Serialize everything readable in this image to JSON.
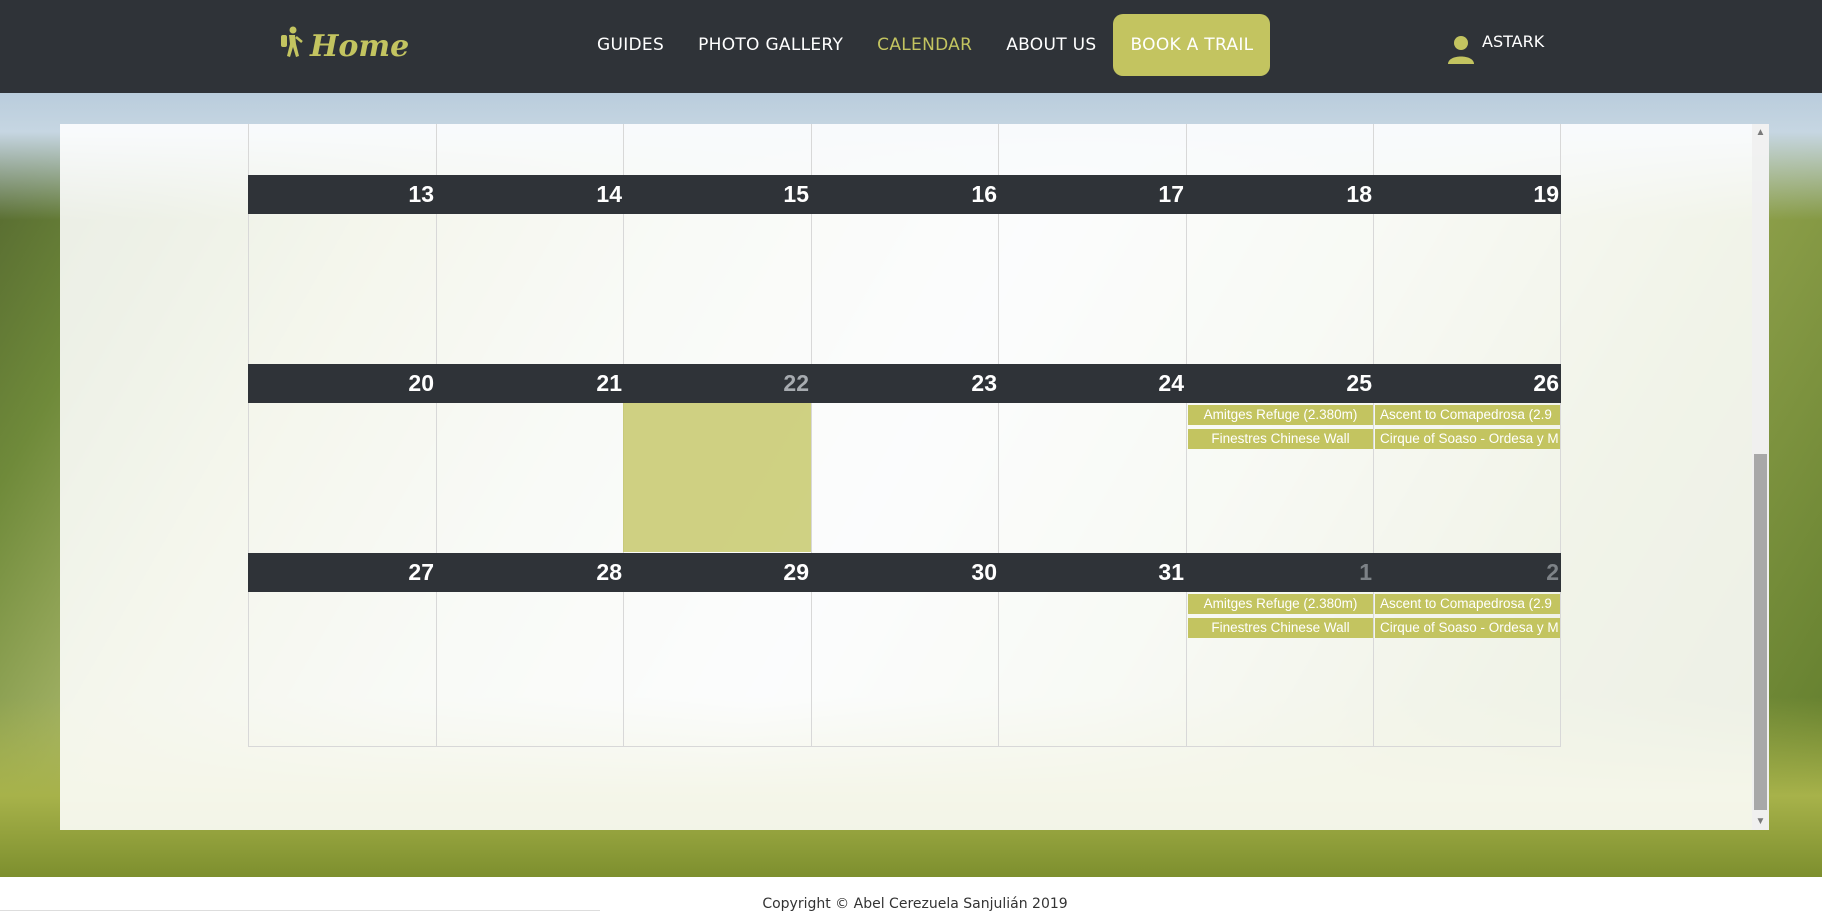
{
  "navbar": {
    "brand": "Home",
    "links": [
      {
        "label": "GUIDES",
        "active": false
      },
      {
        "label": "PHOTO GALLERY",
        "active": false
      },
      {
        "label": "CALENDAR",
        "active": true
      },
      {
        "label": "ABOUT US",
        "active": false
      }
    ],
    "book_button": "BOOK A TRAIL",
    "user": "ASTARK"
  },
  "colors": {
    "accent": "#c3c460",
    "navbar": "#2f3338",
    "week_header": "#2f3338"
  },
  "icons": {
    "brand": "hiker-icon",
    "user": "user-icon"
  },
  "calendar": {
    "weeks": [
      {
        "days": [
          {
            "num": "13"
          },
          {
            "num": "14"
          },
          {
            "num": "15"
          },
          {
            "num": "16"
          },
          {
            "num": "17"
          },
          {
            "num": "18"
          },
          {
            "num": "19"
          }
        ]
      },
      {
        "days": [
          {
            "num": "20"
          },
          {
            "num": "21"
          },
          {
            "num": "22",
            "today": true
          },
          {
            "num": "23"
          },
          {
            "num": "24"
          },
          {
            "num": "25"
          },
          {
            "num": "26"
          }
        ]
      },
      {
        "days": [
          {
            "num": "27"
          },
          {
            "num": "28"
          },
          {
            "num": "29"
          },
          {
            "num": "30"
          },
          {
            "num": "31"
          },
          {
            "num": "1",
            "other": true
          },
          {
            "num": "2",
            "other": true
          }
        ]
      }
    ],
    "events": {
      "week2_day6": [
        "Amitges Refuge (2.380m)",
        "Finestres Chinese Wall"
      ],
      "week2_day7": [
        "Ascent to Comapedrosa (2.9",
        "Cirque of Soaso - Ordesa y M"
      ],
      "week3_day6": [
        "Amitges Refuge (2.380m)",
        "Finestres Chinese Wall"
      ],
      "week3_day7": [
        "Ascent to Comapedrosa (2.9",
        "Cirque of Soaso - Ordesa y M"
      ]
    }
  },
  "footer": {
    "copyright": "Copyright © Abel Cerezuela Sanjulián 2019"
  }
}
